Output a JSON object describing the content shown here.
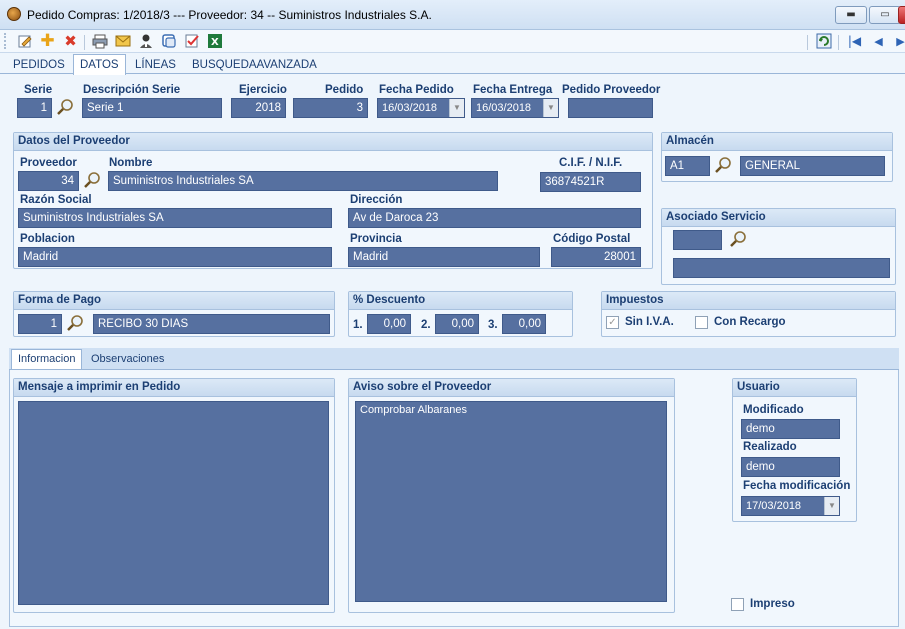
{
  "window": {
    "title": "Pedido Compras: 1/2018/3  ---  Proveedor: 34  --  Suministros Industriales S.A.",
    "min": "▬",
    "max": "▭"
  },
  "toolbar": {
    "icons": [
      "edit-icon",
      "add-icon",
      "delete-icon",
      "print-icon",
      "email-icon",
      "contact-icon",
      "copy-icon",
      "checklist-icon",
      "excel-icon",
      "refresh-icon",
      "first-record-icon",
      "prev-record-icon",
      "next-record-icon"
    ]
  },
  "tabs": [
    "PEDIDOS",
    "DATOS",
    "LÍNEAS",
    "BUSQUEDAAVANZADA"
  ],
  "header": {
    "serie_label": "Serie",
    "serie": "1",
    "desc_label": "Descripción Serie",
    "desc": "Serie 1",
    "ejercicio_label": "Ejercicio",
    "ejercicio": "2018",
    "pedido_label": "Pedido",
    "pedido": "3",
    "fecha_pedido_label": "Fecha Pedido",
    "fecha_pedido": "16/03/2018",
    "fecha_entrega_label": "Fecha Entrega",
    "fecha_entrega": "16/03/2018",
    "pedido_prov_label": "Pedido Proveedor",
    "pedido_prov": ""
  },
  "proveedor": {
    "title": "Datos del Proveedor",
    "proveedor_label": "Proveedor",
    "proveedor": "34",
    "nombre_label": "Nombre",
    "nombre": "Suministros Industriales SA",
    "cif_label": "C.I.F. / N.I.F.",
    "cif": "36874521R",
    "razon_label": "Razón Social",
    "razon": "Suministros Industriales SA",
    "direccion_label": "Dirección",
    "direccion": "Av de Daroca 23",
    "poblacion_label": "Poblacion",
    "poblacion": "Madrid",
    "provincia_label": "Provincia",
    "provincia": "Madrid",
    "cp_label": "Código Postal",
    "cp": "28001"
  },
  "almacen": {
    "title": "Almacén",
    "code": "A1",
    "name": "GENERAL"
  },
  "asociado": {
    "title": "Asociado Servicio",
    "code": "",
    "name": ""
  },
  "forma_pago": {
    "title": "Forma de Pago",
    "code": "1",
    "name": "RECIBO 30 DIAS"
  },
  "descuento": {
    "title": "% Descuento",
    "l1": "1.",
    "v1": "0,00",
    "l2": "2.",
    "v2": "0,00",
    "l3": "3.",
    "v3": "0,00"
  },
  "impuestos": {
    "title": "Impuestos",
    "sin_iva_label": "Sin I.V.A.",
    "sin_iva": true,
    "recargo_label": "Con Recargo",
    "recargo": false
  },
  "subtabs": [
    "Informacion",
    "Observaciones"
  ],
  "mensaje": {
    "title": "Mensaje a imprimir en Pedido",
    "text": ""
  },
  "aviso": {
    "title": "Aviso sobre el Proveedor",
    "text": "Comprobar Albaranes"
  },
  "usuario": {
    "title": "Usuario",
    "modificado_label": "Modificado",
    "modificado": "demo",
    "realizado_label": "Realizado",
    "realizado": "demo",
    "fecha_label": "Fecha modificación",
    "fecha": "17/03/2018"
  },
  "impreso": {
    "label": "Impreso",
    "checked": false
  },
  "colors": {
    "field_bg": "#5670a0",
    "label": "#1c3f73",
    "header_bg": "#c7daef"
  }
}
